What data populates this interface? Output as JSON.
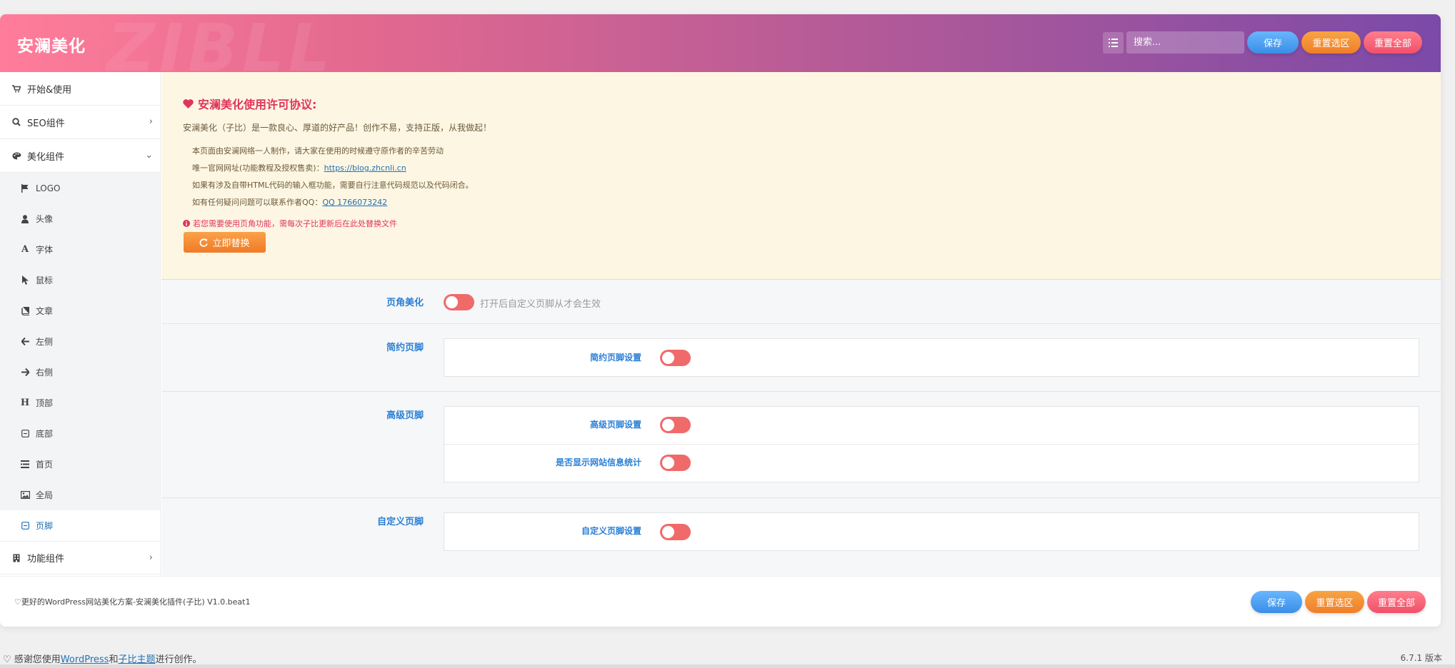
{
  "header": {
    "title": "安澜美化",
    "watermark": "ZIBLL",
    "search_placeholder": "搜索...",
    "save_label": "保存",
    "reset_section_label": "重置选区",
    "reset_all_label": "重置全部"
  },
  "sidebar": {
    "items": [
      {
        "label": "开始&使用",
        "icon": "cart-icon"
      },
      {
        "label": "SEO组件",
        "icon": "search-icon"
      },
      {
        "label": "美化组件",
        "icon": "palette-icon"
      }
    ],
    "sub_items": [
      {
        "label": "LOGO",
        "icon": "flag-icon"
      },
      {
        "label": "头像",
        "icon": "user-icon"
      },
      {
        "label": "字体",
        "icon": "font-icon"
      },
      {
        "label": "鼠标",
        "icon": "cursor-icon"
      },
      {
        "label": "文章",
        "icon": "book-icon"
      },
      {
        "label": "左侧",
        "icon": "arrow-left-icon"
      },
      {
        "label": "右侧",
        "icon": "arrow-right-icon"
      },
      {
        "label": "顶部",
        "icon": "heading-icon"
      },
      {
        "label": "底部",
        "icon": "minus-square-icon"
      },
      {
        "label": "首页",
        "icon": "list-icon"
      },
      {
        "label": "全局",
        "icon": "image-icon"
      },
      {
        "label": "页脚",
        "icon": "minus-square-icon"
      }
    ],
    "last_item": {
      "label": "功能组件",
      "icon": "building-icon"
    }
  },
  "notice": {
    "title": "安澜美化使用许可协议:",
    "intro": "安澜美化（子比）是一款良心、厚道的好产品！创作不易，支持正版，从我做起！",
    "line1": "本页面由安澜网络一人制作，请大家在使用的时候遵守原作者的辛苦劳动",
    "line2_prefix": "唯一官网网址(功能教程及授权售卖)：",
    "line2_link": "https://blog.zhcnli.cn",
    "line3": "如果有涉及自带HTML代码的输入框功能，需要自行注意代码规范以及代码闭合。",
    "line4_prefix": "如有任何疑问问题可以联系作者QQ：",
    "line4_link": "QQ 1766073242",
    "warning": "若您需要使用页角功能，需每次子比更新后在此处替换文件",
    "replace_button": "立即替换"
  },
  "settings": {
    "footer_beautify": {
      "label": "页角美化",
      "hint": "打开后自定义页脚从才会生效"
    },
    "simple_footer": {
      "label": "简约页脚",
      "option": "简约页脚设置"
    },
    "advanced_footer": {
      "label": "高级页脚",
      "option1": "高级页脚设置",
      "option2": "是否显示网站信息统计"
    },
    "custom_footer": {
      "label": "自定义页脚",
      "option": "自定义页脚设置"
    }
  },
  "footer": {
    "text": "♡更好的WordPress网站美化方案-安澜美化插件(子比) V1.0.beat1",
    "save_label": "保存",
    "reset_section_label": "重置选区",
    "reset_all_label": "重置全部"
  },
  "wp_footer": {
    "prefix": "♡ 感谢您使用",
    "wp_link": "WordPress",
    "and": "和",
    "theme_link": "子比主题",
    "suffix": "进行创作。",
    "version": "6.7.1 版本"
  },
  "colors": {
    "accent_blue": "#2a7fd4",
    "toggle_off": "#f06a6a",
    "notice_bg": "#fdf6e3",
    "warning_red": "#e0355b"
  }
}
